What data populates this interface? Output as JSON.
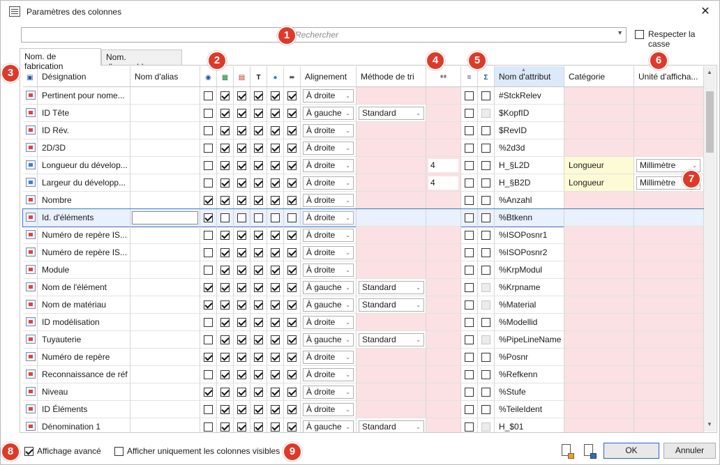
{
  "window": {
    "title": "Paramètres des colonnes"
  },
  "search": {
    "placeholder": "Rechercher",
    "case_label": "Respecter la casse",
    "case_checked": false
  },
  "tabs": [
    {
      "label": "Nom. de fabrication",
      "active": true
    },
    {
      "label": "Nom. d'assemblage",
      "active": false
    }
  ],
  "headers": {
    "designation": "Désignation",
    "alias": "Nom d'alias",
    "alignment": "Alignement",
    "sort_method": "Méthode de tri",
    "attr_name": "Nom d'attribut",
    "category": "Catégorie",
    "unit": "Unité d'afficha...",
    "sum_icon": "Σ",
    "eq_icon": "="
  },
  "rows": [
    {
      "icon": "red",
      "name": "Pertinent pour nome...",
      "cbs": [
        false,
        true,
        true,
        true,
        true,
        true
      ],
      "align": "À droite",
      "sort": "",
      "num": "",
      "eq": false,
      "sum": false,
      "sum_disabled": false,
      "attr": "#StckRelev",
      "category": "",
      "unit": ""
    },
    {
      "icon": "red",
      "name": "ID Tête",
      "cbs": [
        false,
        true,
        true,
        true,
        true,
        true
      ],
      "align": "À gauche",
      "sort": "Standard",
      "num": "",
      "eq": false,
      "sum": false,
      "sum_disabled": true,
      "attr": "$KopfID",
      "category": "",
      "unit": ""
    },
    {
      "icon": "red",
      "name": "ID Rév.",
      "cbs": [
        false,
        true,
        true,
        true,
        true,
        true
      ],
      "align": "À droite",
      "sort": "",
      "num": "",
      "eq": false,
      "sum": false,
      "sum_disabled": false,
      "attr": "$RevID",
      "category": "",
      "unit": ""
    },
    {
      "icon": "red",
      "name": "2D/3D",
      "cbs": [
        false,
        true,
        true,
        true,
        true,
        true
      ],
      "align": "À droite",
      "sort": "",
      "num": "",
      "eq": false,
      "sum": false,
      "sum_disabled": false,
      "attr": "%2d3d",
      "category": "",
      "unit": ""
    },
    {
      "icon": "blue",
      "name": "Longueur du dévelop...",
      "cbs": [
        false,
        true,
        true,
        true,
        true,
        true
      ],
      "align": "À droite",
      "sort": "",
      "num": "4",
      "eq": false,
      "sum": false,
      "sum_disabled": false,
      "attr": "H_§L2D",
      "category": "Longueur",
      "unit": "Millimètre"
    },
    {
      "icon": "blue",
      "name": "Largeur du développ...",
      "cbs": [
        false,
        true,
        true,
        true,
        true,
        true
      ],
      "align": "À droite",
      "sort": "",
      "num": "4",
      "eq": false,
      "sum": false,
      "sum_disabled": false,
      "attr": "H_§B2D",
      "category": "Longueur",
      "unit": "Millimètre"
    },
    {
      "icon": "red",
      "name": "Nombre",
      "cbs": [
        true,
        true,
        true,
        true,
        true,
        true
      ],
      "align": "À droite",
      "sort": "",
      "num": "",
      "eq": false,
      "sum": false,
      "sum_disabled": false,
      "attr": "%Anzahl",
      "category": "",
      "unit": ""
    },
    {
      "icon": "red",
      "name": "Id. d'éléments",
      "cbs": [
        true,
        false,
        false,
        false,
        false,
        false
      ],
      "align": "À droite",
      "sort": "",
      "num": "",
      "eq": false,
      "sum": false,
      "sum_disabled": false,
      "attr": "%Btkenn",
      "category": "",
      "unit": "",
      "selected": true
    },
    {
      "icon": "red",
      "name": "Numéro de repère IS...",
      "cbs": [
        false,
        true,
        true,
        true,
        true,
        true
      ],
      "align": "À droite",
      "sort": "",
      "num": "",
      "eq": false,
      "sum": false,
      "sum_disabled": false,
      "attr": "%ISOPosnr1",
      "category": "",
      "unit": ""
    },
    {
      "icon": "red",
      "name": "Numéro de repère IS...",
      "cbs": [
        false,
        true,
        true,
        true,
        true,
        true
      ],
      "align": "À droite",
      "sort": "",
      "num": "",
      "eq": false,
      "sum": false,
      "sum_disabled": false,
      "attr": "%ISOPosnr2",
      "category": "",
      "unit": ""
    },
    {
      "icon": "red",
      "name": "Module",
      "cbs": [
        false,
        true,
        true,
        true,
        true,
        true
      ],
      "align": "À droite",
      "sort": "",
      "num": "",
      "eq": false,
      "sum": false,
      "sum_disabled": false,
      "attr": "%KrpModul",
      "category": "",
      "unit": ""
    },
    {
      "icon": "red",
      "name": "Nom de l'élément",
      "cbs": [
        true,
        true,
        true,
        true,
        true,
        true
      ],
      "align": "À gauche",
      "sort": "Standard",
      "num": "",
      "eq": false,
      "sum": false,
      "sum_disabled": true,
      "attr": "%Krpname",
      "category": "",
      "unit": ""
    },
    {
      "icon": "red",
      "name": "Nom de matériau",
      "cbs": [
        true,
        true,
        true,
        true,
        true,
        true
      ],
      "align": "À gauche",
      "sort": "Standard",
      "num": "",
      "eq": false,
      "sum": false,
      "sum_disabled": true,
      "attr": "%Material",
      "category": "",
      "unit": ""
    },
    {
      "icon": "red",
      "name": "ID modélisation",
      "cbs": [
        false,
        true,
        true,
        true,
        true,
        true
      ],
      "align": "À droite",
      "sort": "",
      "num": "",
      "eq": false,
      "sum": false,
      "sum_disabled": false,
      "attr": "%Modellid",
      "category": "",
      "unit": ""
    },
    {
      "icon": "red",
      "name": "Tuyauterie",
      "cbs": [
        false,
        true,
        true,
        true,
        true,
        true
      ],
      "align": "À gauche",
      "sort": "Standard",
      "num": "",
      "eq": false,
      "sum": false,
      "sum_disabled": true,
      "attr": "%PipeLineName",
      "category": "",
      "unit": ""
    },
    {
      "icon": "red",
      "name": "Numéro de repère",
      "cbs": [
        true,
        true,
        true,
        true,
        true,
        true
      ],
      "align": "À droite",
      "sort": "",
      "num": "",
      "eq": false,
      "sum": false,
      "sum_disabled": false,
      "attr": "%Posnr",
      "category": "",
      "unit": ""
    },
    {
      "icon": "red",
      "name": "Reconnaissance de réf",
      "cbs": [
        false,
        true,
        true,
        true,
        true,
        true
      ],
      "align": "À droite",
      "sort": "",
      "num": "",
      "eq": false,
      "sum": false,
      "sum_disabled": false,
      "attr": "%Refkenn",
      "category": "",
      "unit": ""
    },
    {
      "icon": "red",
      "name": "Niveau",
      "cbs": [
        true,
        true,
        true,
        true,
        true,
        true
      ],
      "align": "À droite",
      "sort": "",
      "num": "",
      "eq": false,
      "sum": false,
      "sum_disabled": false,
      "attr": "%Stufe",
      "category": "",
      "unit": ""
    },
    {
      "icon": "red",
      "name": "ID Éléments",
      "cbs": [
        false,
        true,
        true,
        true,
        true,
        true
      ],
      "align": "À droite",
      "sort": "",
      "num": "",
      "eq": false,
      "sum": false,
      "sum_disabled": false,
      "attr": "%TeileIdent",
      "category": "",
      "unit": ""
    },
    {
      "icon": "red",
      "name": "Dénomination 1",
      "cbs": [
        false,
        true,
        true,
        true,
        true,
        true
      ],
      "align": "À gauche",
      "sort": "Standard",
      "num": "",
      "eq": false,
      "sum": false,
      "sum_disabled": true,
      "attr": "H_$01",
      "category": "",
      "unit": ""
    }
  ],
  "callouts": [
    "1",
    "2",
    "3",
    "4",
    "5",
    "6",
    "7",
    "8",
    "9"
  ],
  "footer": {
    "advanced_label": "Affichage avancé",
    "advanced_checked": true,
    "visible_only_label": "Afficher uniquement les colonnes visibles",
    "visible_only_checked": false,
    "ok_label": "OK",
    "cancel_label": "Annuler"
  },
  "colors": {
    "pink": "#fbe1e3",
    "yellow": "#fdfbd6",
    "callout": "#dd3a2a",
    "selection": "#3b7bd4"
  }
}
